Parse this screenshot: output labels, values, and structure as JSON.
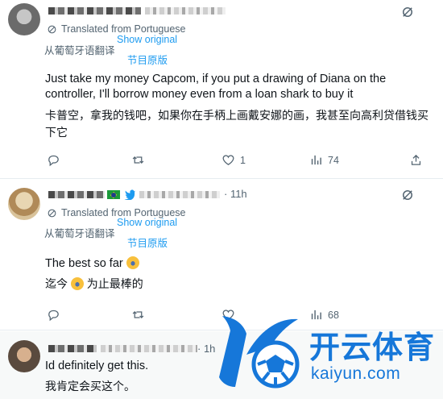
{
  "colors": {
    "link": "#1d9bf0",
    "muted": "#536471",
    "text": "#0f1419",
    "watermark": "#1677d9"
  },
  "icons": [
    "grok-icon",
    "translate-icon",
    "reply-icon",
    "retweet-icon",
    "like-icon",
    "views-icon"
  ],
  "tweets": [
    {
      "translated_from": "Translated from Portuguese",
      "translated_from_cn": "从葡萄牙语翻译",
      "show_original": "Show original",
      "show_original_cn": "节目原版",
      "text_line1": "Just take my money Capcom, if you put a drawing of Diana on the",
      "text_line2": "controller, I'll borrow money even from a loan shark to buy it",
      "cn_line1": "卡普空，拿我的钱吧，如果你在手柄上画戴安娜的画，我甚至向高利贷借钱买",
      "cn_line2": "下它",
      "likes": "1",
      "views": "74"
    },
    {
      "time": "· 11h",
      "translated_from": "Translated from Portuguese",
      "translated_from_cn": "从葡萄牙语翻译",
      "show_original": "Show original",
      "show_original_cn": "节目原版",
      "text": "The best so far",
      "cn_prefix": "迄今",
      "cn_suffix": "为止最棒的",
      "views": "68"
    },
    {
      "time": "· 1h",
      "text": "Id definitely get this.",
      "cn": "我肯定会买这个。"
    }
  ],
  "watermark": {
    "title": "开云体育",
    "url": "kaiyun.com"
  }
}
